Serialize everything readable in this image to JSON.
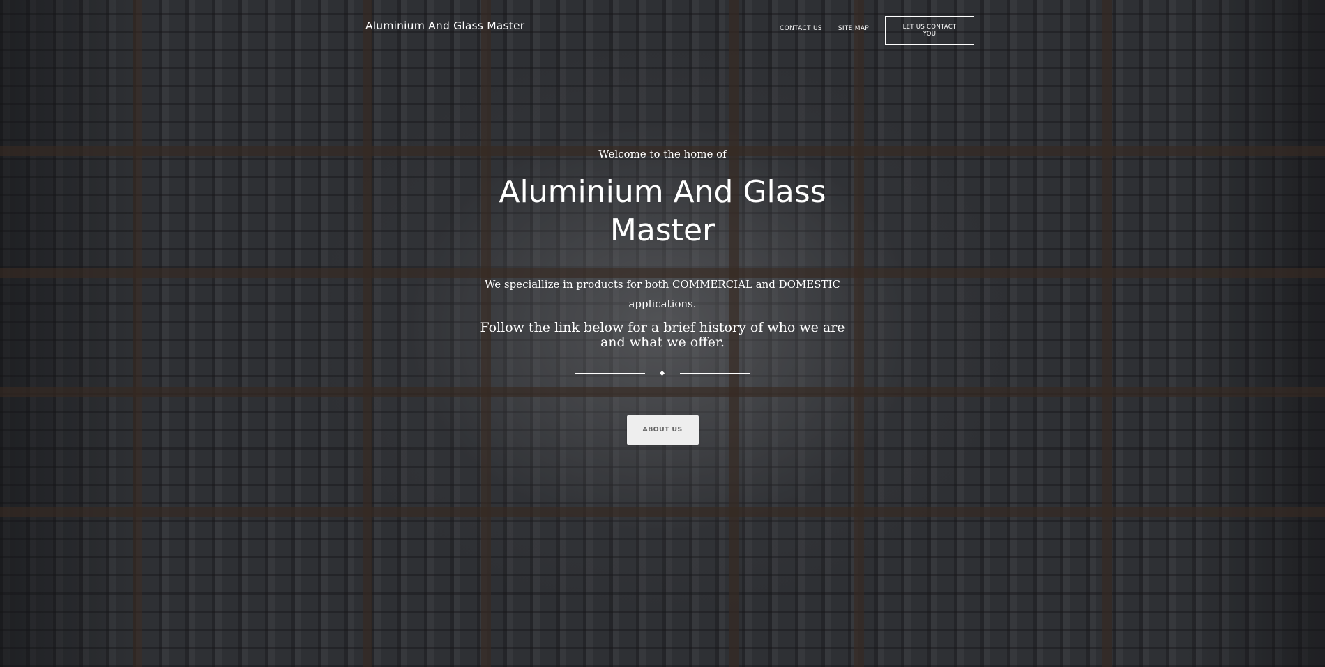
{
  "header": {
    "brand": "Aluminium And Glass Master",
    "nav": [
      {
        "label": "CONTACT US"
      },
      {
        "label": "SITE MAP"
      }
    ],
    "cta_label": "LET US CONTACT YOU"
  },
  "hero": {
    "kicker": "Welcome to the home of",
    "title": "Aluminium And Glass Master",
    "text": "We speciallize in products for both COMMERCIAL and DOMESTIC applications.",
    "text_large": "Follow the link below for a brief history of who we are and what we offer.",
    "button_label": "ABOUT US",
    "background": "dark-building-grid-photo"
  },
  "colors": {
    "text": "#ffffff",
    "button_bg": "#eeeeee",
    "button_text": "#666666",
    "overlay": "#2e3033"
  }
}
